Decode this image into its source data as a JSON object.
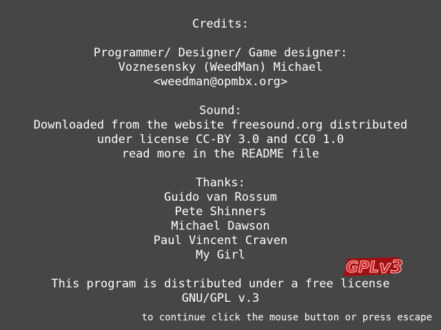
{
  "credits": {
    "title": "Credits:",
    "programmer_heading": "Programmer/ Designer/ Game designer:",
    "programmer_name": "Voznesensky (WeedMan) Michael",
    "programmer_email": "<weedman@opmbx.org>",
    "sound_heading": "Sound:",
    "sound_line1": "Downloaded from the website freesound.org distributed",
    "sound_line2": "under license CC-BY 3.0 and CC0 1.0",
    "sound_line3": "read more in the README file",
    "thanks_heading": "Thanks:",
    "thanks": [
      "Guido van Rossum",
      "Pete Shinners",
      "Michael Dawson",
      "Paul Vincent Craven",
      "My Girl"
    ],
    "license_line1": "This program is distributed under a free license",
    "license_line2": "GNU/GPL v.3"
  },
  "logo": {
    "text": "GPLv3",
    "color": "#cc1f1f"
  },
  "footer": {
    "hint": "to continue click the mouse button or press escape"
  }
}
